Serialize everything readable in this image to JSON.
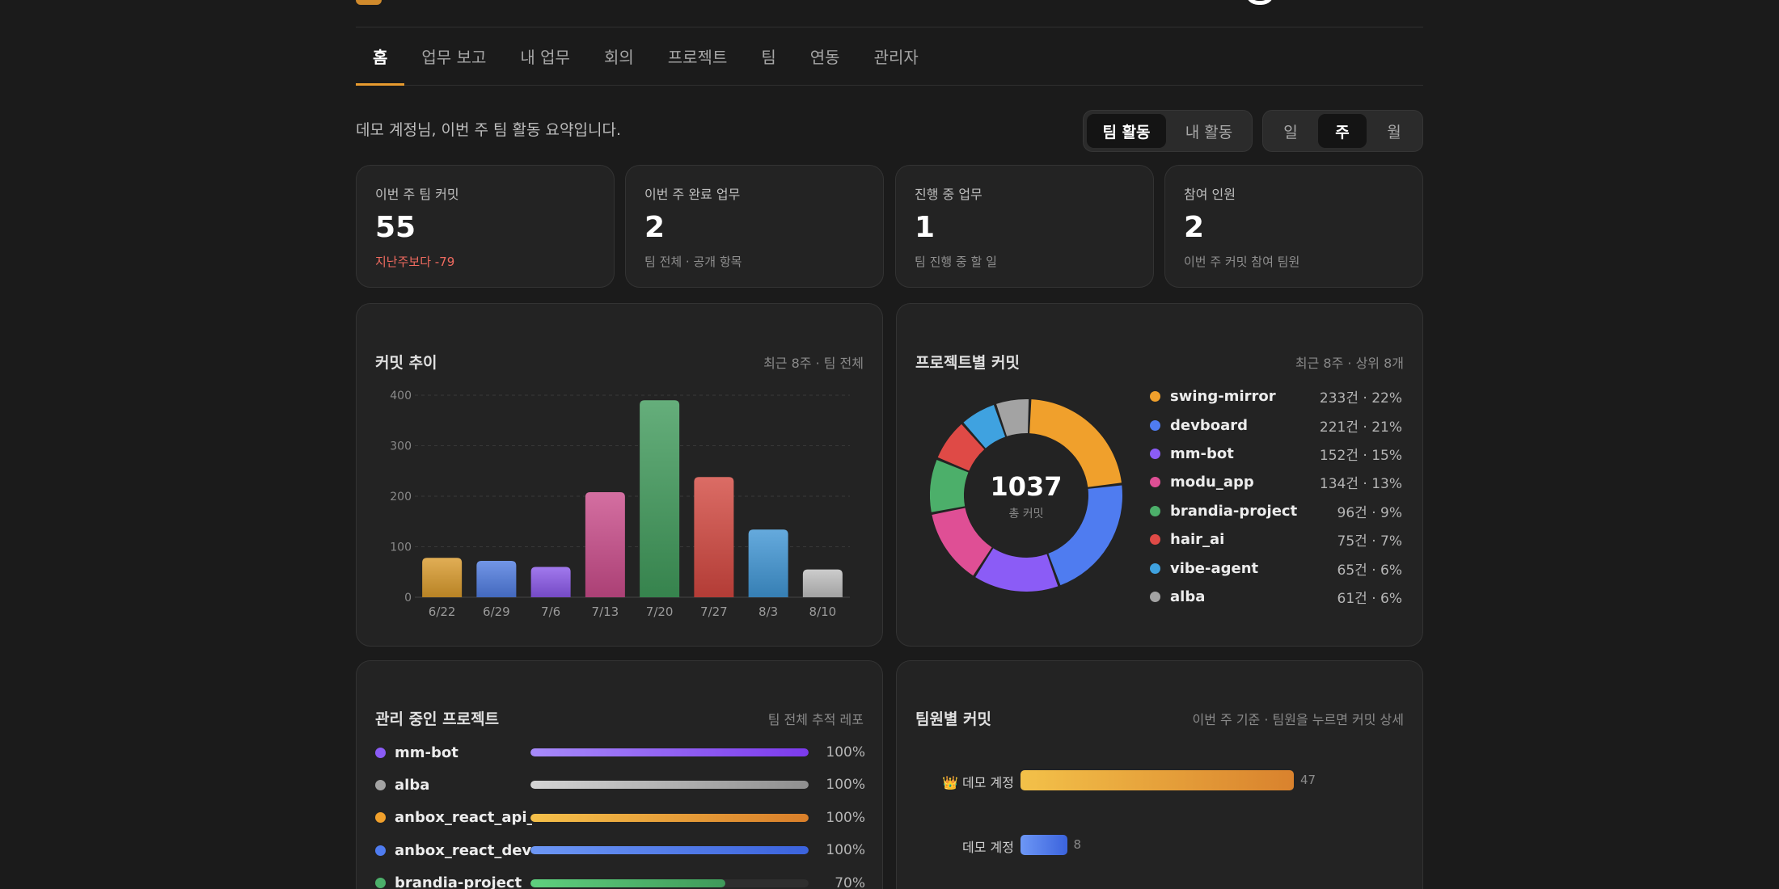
{
  "tabs": [
    "홈",
    "업무 보고",
    "내 업무",
    "회의",
    "프로젝트",
    "팀",
    "연동",
    "관리자"
  ],
  "active_tab": 0,
  "greeting": "데모 계정님, 이번 주 팀 활동 요약입니다.",
  "scope_toggle": {
    "options": [
      "팀 활동",
      "내 활동"
    ],
    "selected": "팀 활동"
  },
  "period_toggle": {
    "options": [
      "일",
      "주",
      "월"
    ],
    "selected": "주"
  },
  "stats": [
    {
      "label": "이번 주 팀 커밋",
      "value": "55",
      "sub": "지난주보다 -79",
      "negative": true
    },
    {
      "label": "이번 주 완료 업무",
      "value": "2",
      "sub": "팀 전체 · 공개 항목",
      "negative": false
    },
    {
      "label": "진행 중 업무",
      "value": "1",
      "sub": "팀 진행 중 할 일",
      "negative": false
    },
    {
      "label": "참여 인원",
      "value": "2",
      "sub": "이번 주 커밋 참여 팀원",
      "negative": false
    }
  ],
  "commit_trend": {
    "title": "커밋 추이",
    "meta": "최근 8주 · 팀 전체"
  },
  "project_commits": {
    "title": "프로젝트별 커밋",
    "meta": "최근 8주 · 상위 8개",
    "total": "1037",
    "total_label": "총 커밋"
  },
  "managed_projects": {
    "title": "관리 중인 프로젝트",
    "meta": "팀 전체 추적 레포",
    "items": [
      {
        "name": "mm-bot",
        "progress": 100,
        "label": "100%",
        "color": "#8b5cf6",
        "grad": [
          "#a78bfa",
          "#7c3aed"
        ]
      },
      {
        "name": "alba",
        "progress": 100,
        "label": "100%",
        "color": "#a3a3a3",
        "grad": [
          "#d4d4d4",
          "#8f8f8f"
        ]
      },
      {
        "name": "anbox_react_api_",
        "progress": 100,
        "label": "100%",
        "color": "#f0a02c",
        "grad": [
          "#f5c04a",
          "#d97f2a"
        ]
      },
      {
        "name": "anbox_react_dev",
        "progress": 100,
        "label": "100%",
        "color": "#4f7cf0",
        "grad": [
          "#6d97f5",
          "#3b63dd"
        ]
      },
      {
        "name": "brandia-project",
        "progress": 70,
        "label": "70%",
        "color": "#4caf6a",
        "grad": [
          "#5fd07e",
          "#3f9a5a"
        ]
      }
    ]
  },
  "member_commits": {
    "title": "팀원별 커밋",
    "meta": "이번 주 기준 · 팀원을 누르면 커밋 상세",
    "max": 47,
    "items": [
      {
        "name": "👑 데모 계정",
        "count": 47,
        "count_label": "47",
        "grad": [
          "#f3c149",
          "#d9822d"
        ]
      },
      {
        "name": "데모 계정",
        "count": 8,
        "count_label": "8",
        "grad": [
          "#6d97f5",
          "#3b63dd"
        ]
      }
    ]
  },
  "chart_data": [
    {
      "type": "bar",
      "title": "커밋 추이",
      "categories": [
        "6/22",
        "6/29",
        "7/6",
        "7/13",
        "7/20",
        "7/27",
        "8/3",
        "8/10"
      ],
      "values": [
        78,
        72,
        60,
        208,
        390,
        238,
        134,
        55
      ],
      "ylim": [
        0,
        400
      ],
      "yticks": [
        0,
        100,
        200,
        300,
        400
      ],
      "grid": true,
      "colors": [
        "#d99a2b",
        "#4f7ce0",
        "#8a57e8",
        "#c94b8a",
        "#3f9a5a",
        "#d2473f",
        "#3f95d4",
        "#bfbfbf"
      ]
    },
    {
      "type": "pie",
      "title": "프로젝트별 커밋",
      "labels": [
        "swing-mirror",
        "devboard",
        "mm-bot",
        "modu_app",
        "brandia-project",
        "hair_ai",
        "vibe-agent",
        "alba"
      ],
      "values": [
        233,
        221,
        152,
        134,
        96,
        75,
        65,
        61
      ],
      "value_labels": [
        "233건 · 22%",
        "221건 · 21%",
        "152건 · 15%",
        "134건 · 13%",
        "96건 · 9%",
        "75건 · 7%",
        "65건 · 6%",
        "61건 · 6%"
      ],
      "colors": [
        "#f0a02c",
        "#4f7cf0",
        "#8b5cf6",
        "#df4f95",
        "#4caf6a",
        "#df4a46",
        "#3fa2e0",
        "#a3a3a3"
      ],
      "total": 1037
    }
  ]
}
